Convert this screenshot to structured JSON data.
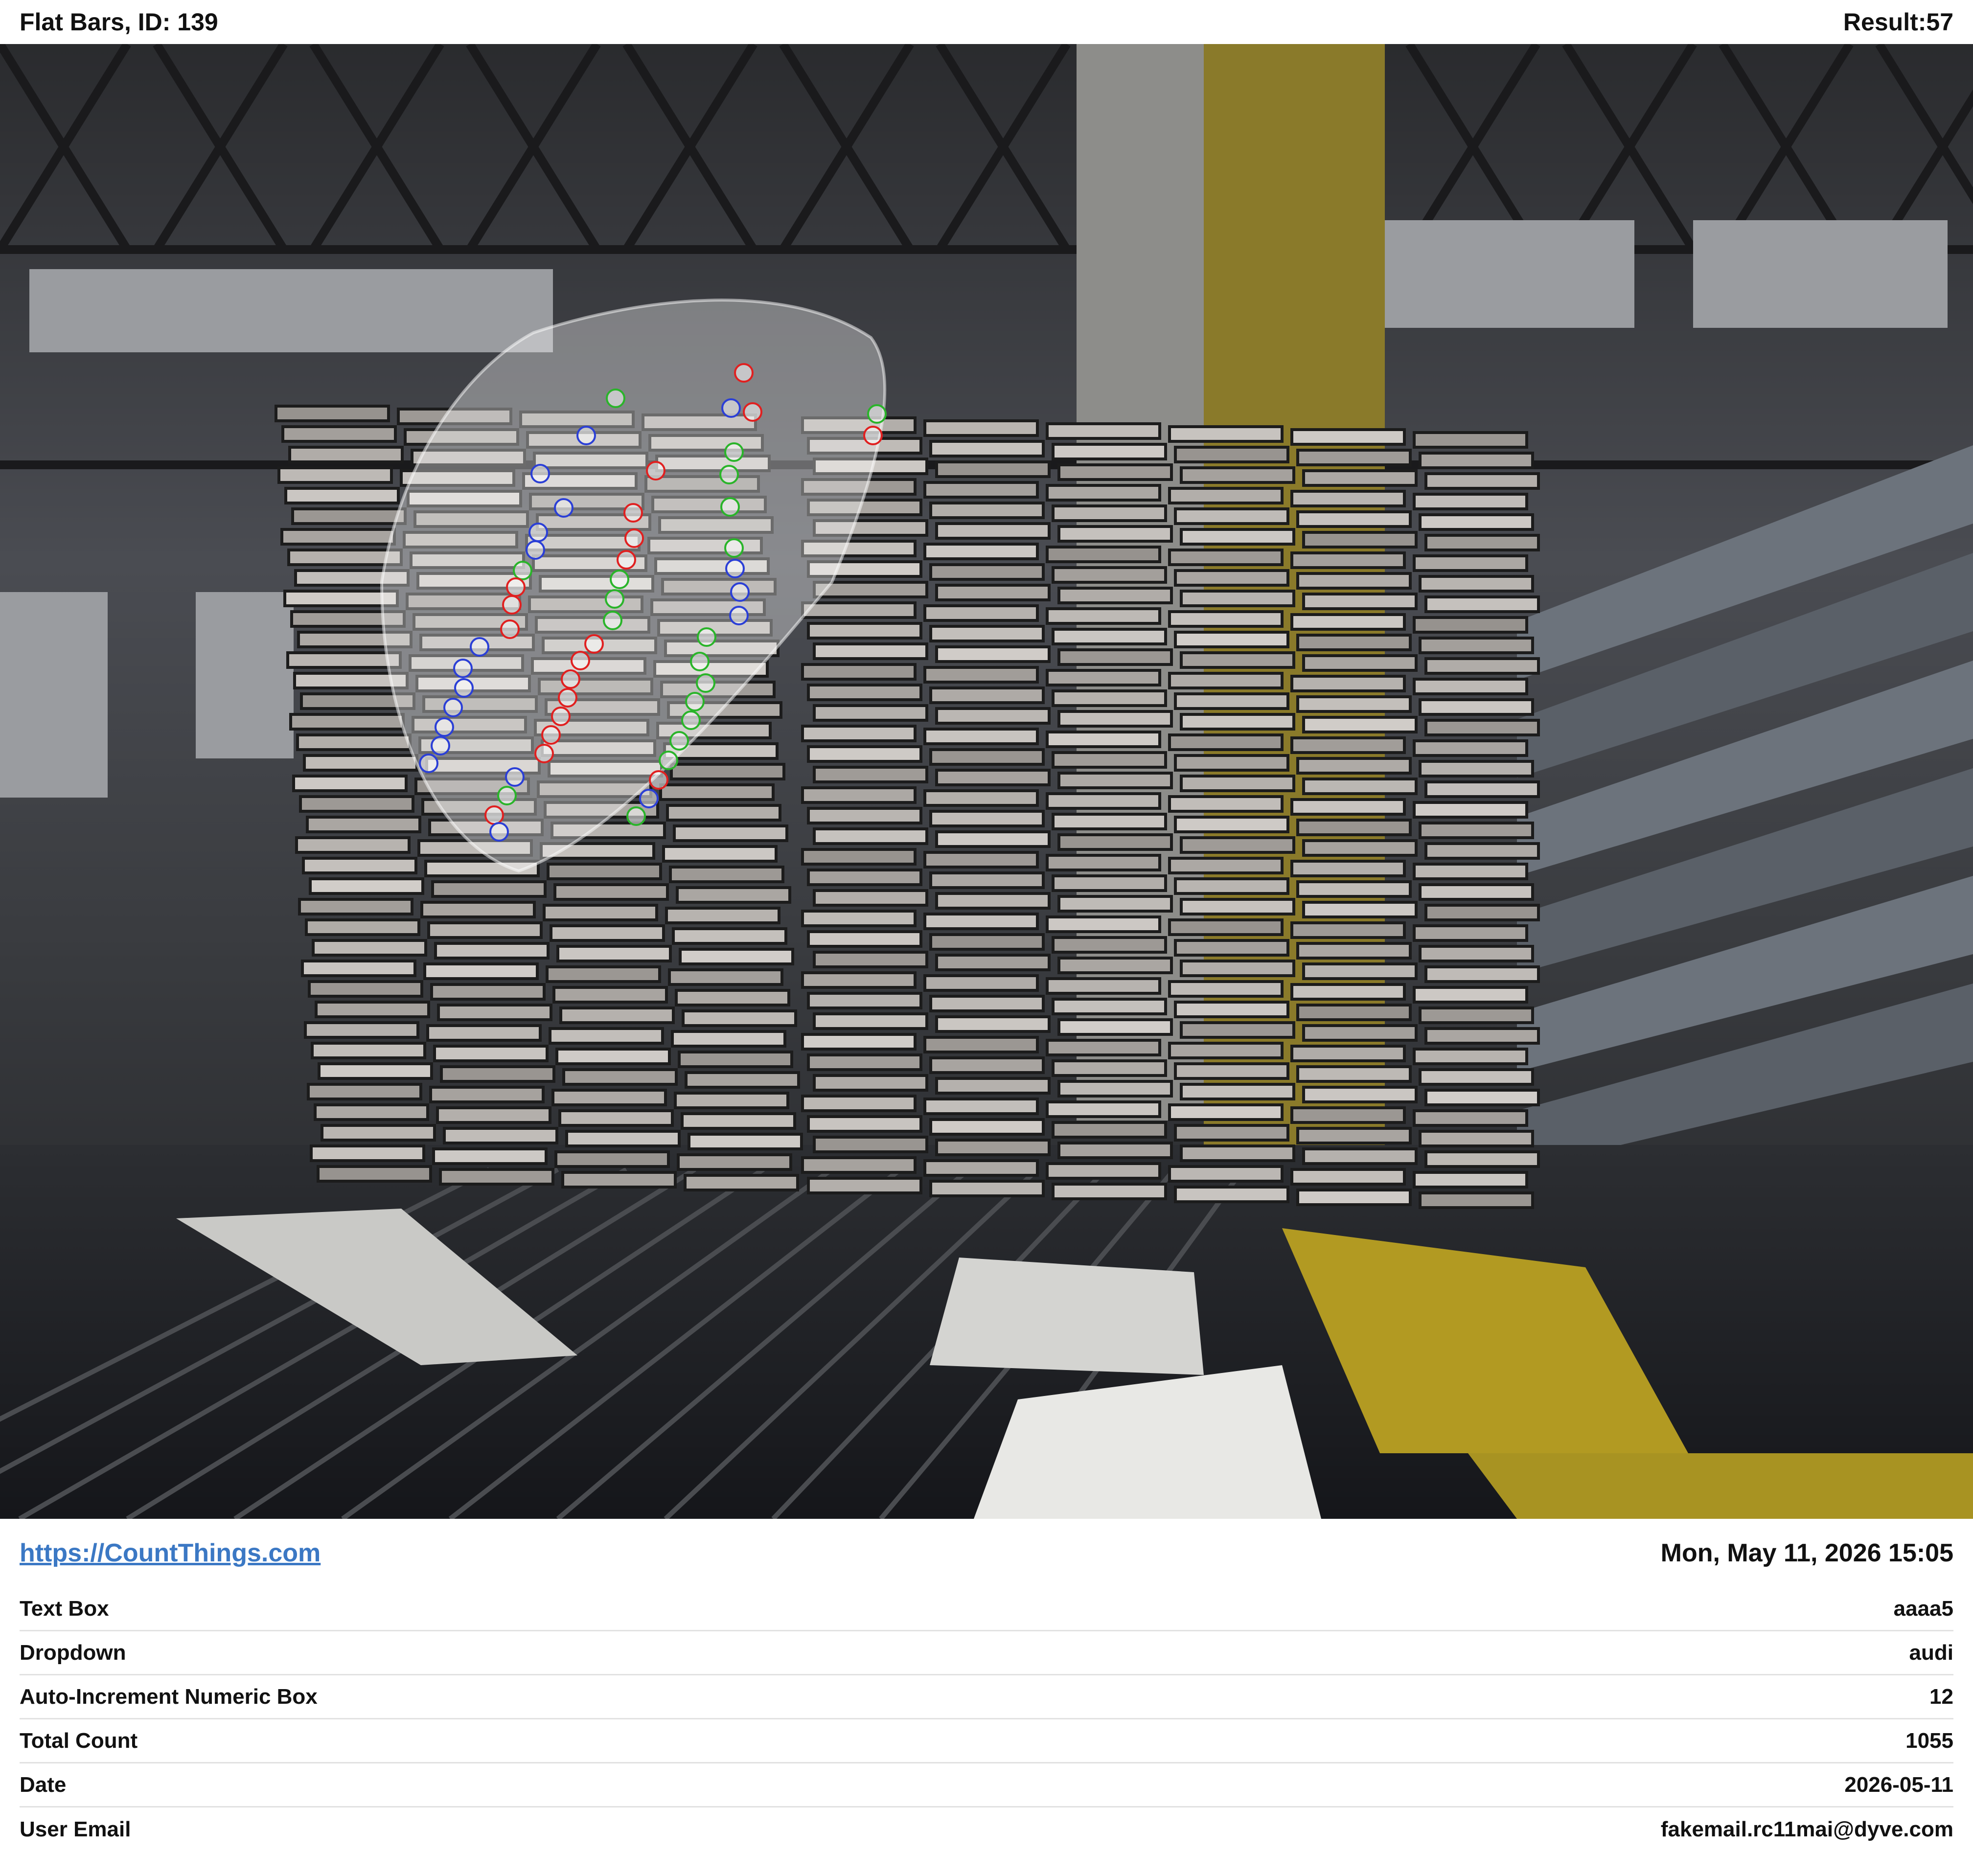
{
  "header": {
    "title": "Flat Bars, ID: 139",
    "result": "Result:57"
  },
  "photo": {
    "subject": "flat-bars-stack-photo",
    "mark_colors": [
      "#e02020",
      "#2ab42a",
      "#2b3fd6"
    ],
    "lens_fill": "#ffffff"
  },
  "footer": {
    "link": "https://CountThings.com",
    "timestamp": "Mon, May 11, 2026 15:05"
  },
  "fields": [
    {
      "label": "Text Box",
      "value": "aaaa5"
    },
    {
      "label": "Dropdown",
      "value": "audi"
    },
    {
      "label": "Auto-Increment Numeric Box",
      "value": "12"
    },
    {
      "label": "Total Count",
      "value": "1055"
    },
    {
      "label": "Date",
      "value": "2026-05-11"
    },
    {
      "label": "User Email",
      "value": "fakemail.rc11mai@dyve.com"
    }
  ]
}
